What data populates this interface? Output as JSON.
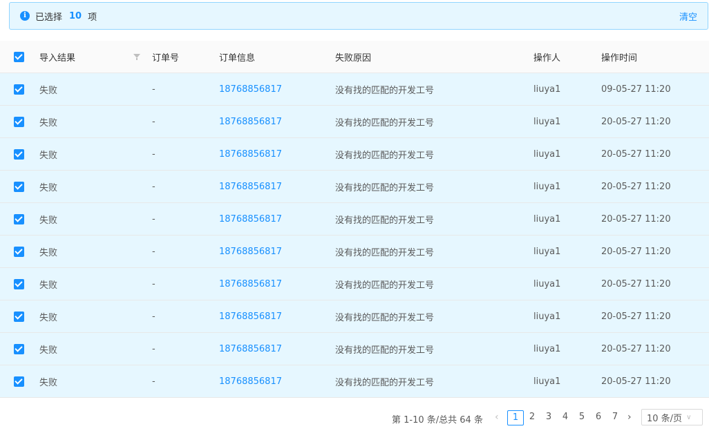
{
  "alert": {
    "prefix": "已选择",
    "count": "10",
    "suffix": "项",
    "clear_label": "清空"
  },
  "table": {
    "headers": {
      "result": "导入结果",
      "order_no": "订单号",
      "order_info": "订单信息",
      "reason": "失败原因",
      "operator": "操作人",
      "time": "操作时间"
    },
    "rows": [
      {
        "result": "失败",
        "order_no": "-",
        "order_info": "18768856817",
        "reason": "没有找的匹配的开发工号",
        "operator": "liuya1",
        "time": "09-05-27 11:20"
      },
      {
        "result": "失败",
        "order_no": "-",
        "order_info": "18768856817",
        "reason": "没有找的匹配的开发工号",
        "operator": "liuya1",
        "time": "20-05-27 11:20"
      },
      {
        "result": "失败",
        "order_no": "-",
        "order_info": "18768856817",
        "reason": "没有找的匹配的开发工号",
        "operator": "liuya1",
        "time": "20-05-27 11:20"
      },
      {
        "result": "失败",
        "order_no": "-",
        "order_info": "18768856817",
        "reason": "没有找的匹配的开发工号",
        "operator": "liuya1",
        "time": "20-05-27 11:20"
      },
      {
        "result": "失败",
        "order_no": "-",
        "order_info": "18768856817",
        "reason": "没有找的匹配的开发工号",
        "operator": "liuya1",
        "time": "20-05-27 11:20"
      },
      {
        "result": "失败",
        "order_no": "-",
        "order_info": "18768856817",
        "reason": "没有找的匹配的开发工号",
        "operator": "liuya1",
        "time": "20-05-27 11:20"
      },
      {
        "result": "失败",
        "order_no": "-",
        "order_info": "18768856817",
        "reason": "没有找的匹配的开发工号",
        "operator": "liuya1",
        "time": "20-05-27 11:20"
      },
      {
        "result": "失败",
        "order_no": "-",
        "order_info": "18768856817",
        "reason": "没有找的匹配的开发工号",
        "operator": "liuya1",
        "time": "20-05-27 11:20"
      },
      {
        "result": "失败",
        "order_no": "-",
        "order_info": "18768856817",
        "reason": "没有找的匹配的开发工号",
        "operator": "liuya1",
        "time": "20-05-27 11:20"
      },
      {
        "result": "失败",
        "order_no": "-",
        "order_info": "18768856817",
        "reason": "没有找的匹配的开发工号",
        "operator": "liuya1",
        "time": "20-05-27 11:20"
      }
    ]
  },
  "pagination": {
    "total_text": "第 1-10 条/总共 64 条",
    "prev_icon": "‹",
    "pages": [
      "1",
      "2",
      "3",
      "4",
      "5",
      "6",
      "7"
    ],
    "current_page": "1",
    "next_icon": "›",
    "page_size": "10 条/页"
  },
  "colors": {
    "accent": "#1890ff",
    "selected_row_bg": "#e6f7ff",
    "header_bg": "#fafafa"
  }
}
